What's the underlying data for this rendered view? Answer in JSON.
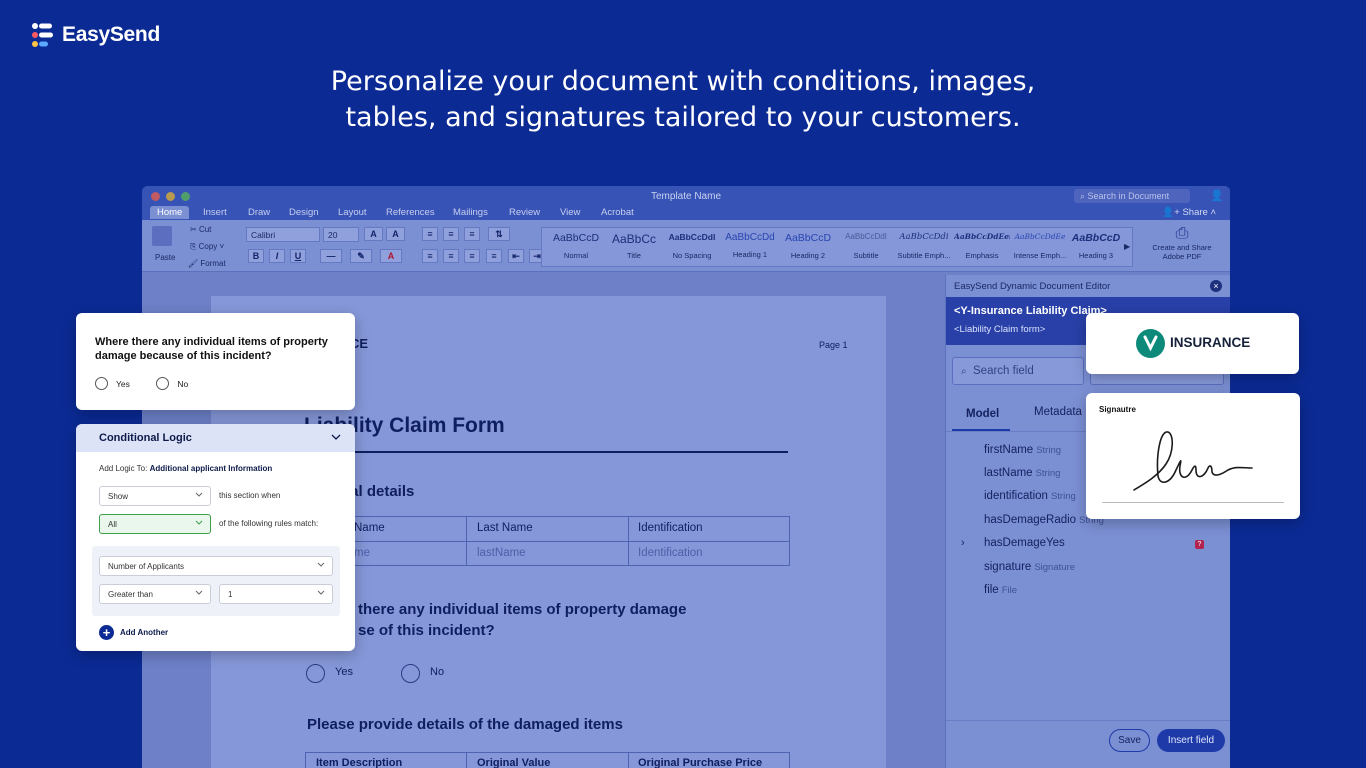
{
  "brand": {
    "name": "EasySend",
    "accent": "#0b2a94"
  },
  "headline": {
    "line1": "Personalize your document with conditions, images,",
    "line2": "tables, and signatures tailored to your customers."
  },
  "window": {
    "title": "Template Name",
    "search_placeholder": "Search in Document",
    "tabs": [
      "Home",
      "Insert",
      "Draw",
      "Design",
      "Layout",
      "References",
      "Mailings",
      "Review",
      "View",
      "Acrobat"
    ],
    "share_label": "Share"
  },
  "ribbon": {
    "paste": "Paste",
    "cut": "Cut",
    "copy": "Copy",
    "format": "Format",
    "font": "Calibri",
    "size": "20",
    "styles": [
      {
        "sample": "AaBbCcD",
        "name": "Normal"
      },
      {
        "sample": "AaBbCc",
        "name": "Title"
      },
      {
        "sample": "AaBbCcDdI",
        "name": "No Spacing"
      },
      {
        "sample": "AaBbCcDd",
        "name": "Heading 1"
      },
      {
        "sample": "AaBbCcD",
        "name": "Heading 2"
      },
      {
        "sample": "AaBbCcDdI",
        "name": "Subtitle"
      },
      {
        "sample": "AaBbCcDdi",
        "name": "Subtitle Emph..."
      },
      {
        "sample": "AaBbCcDdEei",
        "name": "Emphasis"
      },
      {
        "sample": "AaBbCcDdEe",
        "name": "Intense Emph..."
      },
      {
        "sample": "AaBbCcD",
        "name": "Heading 3"
      }
    ],
    "create_pdf": "Create and Share Adobe PDF"
  },
  "document": {
    "header_fragment": "CE",
    "page_label": "Page 1",
    "title": "Liability Claim Form",
    "section1": "nal details",
    "table1": {
      "headers": [
        "Name",
        "Last Name",
        "Identification"
      ],
      "row": [
        "me",
        "lastName",
        "Identification"
      ]
    },
    "question_line1": "there any individual items of property damage",
    "question_line2": "se of this incident?",
    "yes": "Yes",
    "no": "No",
    "section2": "Please provide details of the damaged items",
    "table2_headers": [
      "Item Description",
      "Original Value",
      "Original Purchase Price"
    ]
  },
  "panel": {
    "title": "EasySend Dynamic Document Editor",
    "banner_title": "<Y-Insurance Liability Claim>",
    "banner_sub": "<Liability Claim form>",
    "search_placeholder": "Search field",
    "tabs": [
      "Model",
      "Metadata"
    ],
    "fields": [
      {
        "name": "firstName",
        "type": "String"
      },
      {
        "name": "lastName",
        "type": "String"
      },
      {
        "name": "identification",
        "type": "String"
      },
      {
        "name": "hasDemageRadio",
        "type": "String"
      },
      {
        "name": "hasDemageYes",
        "type": ""
      },
      {
        "name": "signature",
        "type": "Signature"
      },
      {
        "name": "file",
        "type": "File"
      }
    ],
    "save": "Save",
    "insert": "Insert field"
  },
  "question_card": {
    "question": "Where there any individual items of property damage because of this incident?",
    "yes": "Yes",
    "no": "No"
  },
  "logic_card": {
    "title": "Conditional Logic",
    "add_logic_prefix": "Add Logic To:",
    "add_logic_target": "Additional applicant Information",
    "action": "Show",
    "action_suffix": "this section when",
    "match": "All",
    "match_suffix": "of the following rules match:",
    "rule_field": "Number of Applicants",
    "rule_op": "Greater than",
    "rule_value": "1",
    "add_another": "Add Another"
  },
  "insurance_card": {
    "label": "INSURANCE",
    "brand_color": "#0d8a7a"
  },
  "signature_card": {
    "label": "Signautre"
  }
}
